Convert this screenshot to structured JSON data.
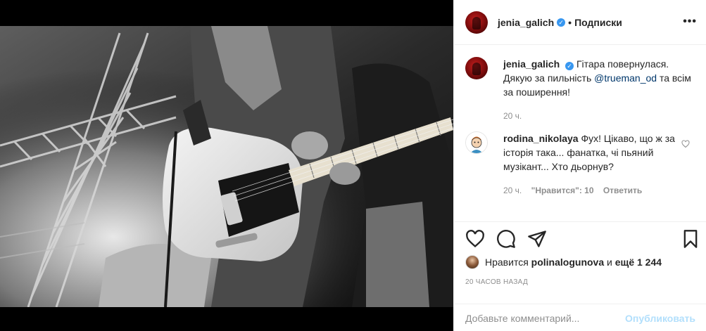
{
  "header": {
    "username": "jenia_galich",
    "separator": "•",
    "follow_label": "Подписки",
    "more_label": "•••"
  },
  "caption": {
    "username": "jenia_galich",
    "text_before": "Гітара повернулася. Дякую за пильність ",
    "mention": "@trueman_od",
    "text_after": " та всім за поширення!",
    "time": "20 ч."
  },
  "comment": {
    "username": "rodina_nikolaya",
    "text": "Фух! Цікаво, що ж за історія така... фанатка, чі пьяний музікант... Хто дьорнув?",
    "time": "20 ч.",
    "likes": "\"Нравится\": 10",
    "reply_label": "Ответить"
  },
  "likes": {
    "prefix": "Нравится",
    "user": "polinalogunova",
    "conjunction": "и",
    "others": "ещё 1 244"
  },
  "post_time": "20 часов назад",
  "add_comment": {
    "placeholder": "Добавьте комментарий...",
    "publish_label": "Опубликовать"
  },
  "icons": {
    "like": "heart-icon",
    "comment": "comment-icon",
    "share": "share-icon",
    "save": "bookmark-icon",
    "verified": "verified-badge-icon",
    "comment_like": "heart-icon"
  },
  "colors": {
    "verified": "#3897f0",
    "link": "#00376b",
    "publish_disabled": "#b2dffc",
    "secondary_text": "#8e8e8e"
  }
}
